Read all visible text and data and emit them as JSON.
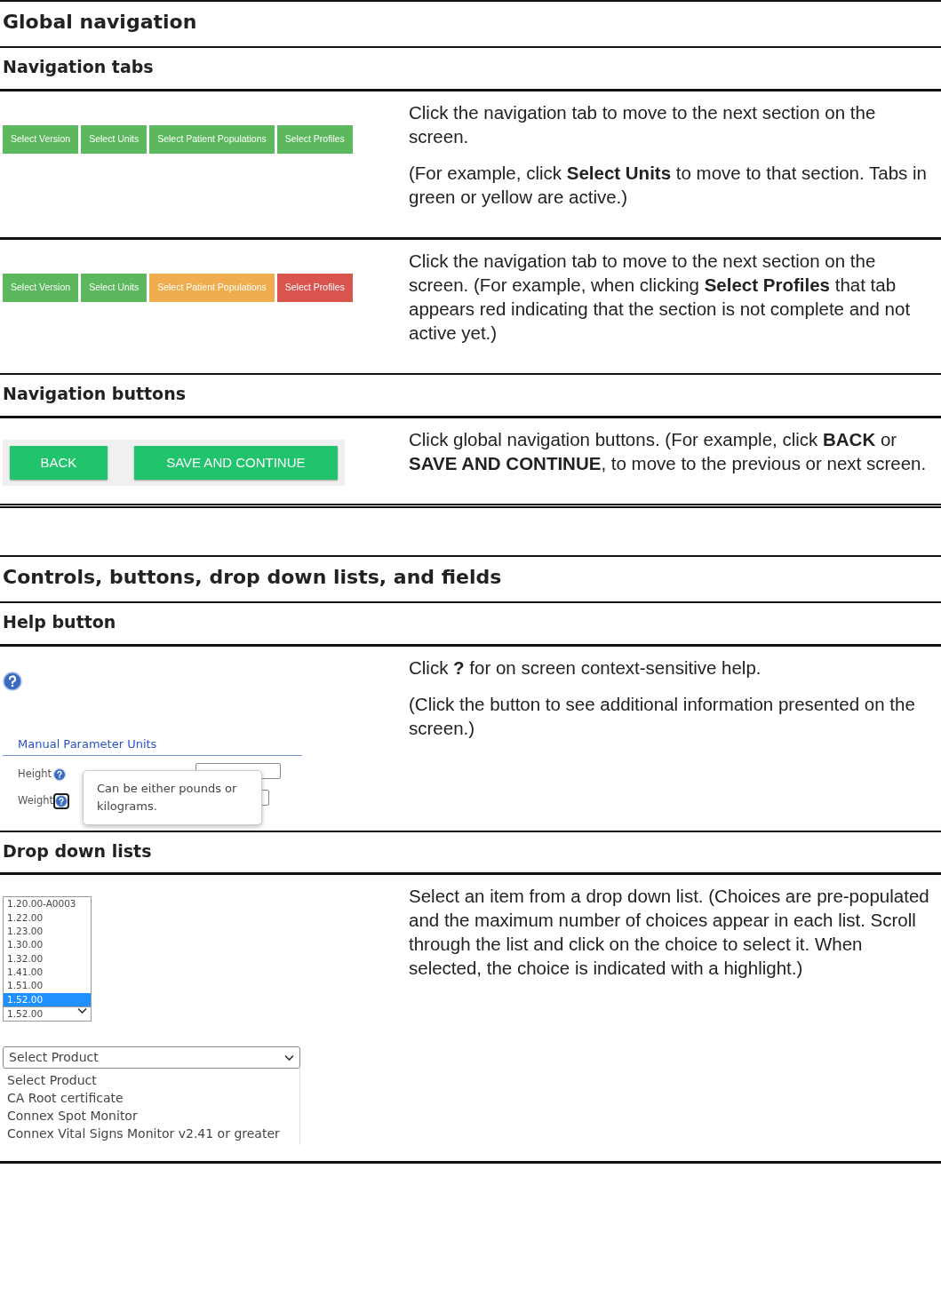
{
  "sections": [
    {
      "title": "Global navigation",
      "subsections": [
        {
          "title": "Navigation tabs",
          "rows": [
            {
              "demo": {
                "kind": "tabs",
                "tabs": [
                  {
                    "label": "Select Version",
                    "color": "#5cb85c"
                  },
                  {
                    "label": "Select Units",
                    "color": "#5cb85c"
                  },
                  {
                    "label": "Select Patient Populations",
                    "color": "#5cb85c"
                  },
                  {
                    "label": "Select Profiles",
                    "color": "#5cb85c"
                  }
                ]
              },
              "paragraphs": [
                "Click the navigation tab to move to the next section on the screen.",
                "(For example, click **Select Units** to move to that section. Tabs in green or yellow are active.)"
              ]
            },
            {
              "demo": {
                "kind": "tabs",
                "tabs": [
                  {
                    "label": "Select Version",
                    "color": "#5cb85c"
                  },
                  {
                    "label": "Select Units",
                    "color": "#5cb85c"
                  },
                  {
                    "label": "Select Patient Populations",
                    "color": "#f0ad4e"
                  },
                  {
                    "label": "Select Profiles",
                    "color": "#d9534f"
                  }
                ]
              },
              "paragraphs": [
                "Click the navigation tab to move to the next section on the screen. (For example, when clicking **Select Profiles** that tab appears red indicating that the section is not complete and not active yet.)"
              ]
            }
          ]
        },
        {
          "title": "Navigation buttons",
          "rows": [
            {
              "demo": {
                "kind": "buttons",
                "buttons": [
                  "BACK",
                  "SAVE AND CONTINUE"
                ]
              },
              "paragraphs": [
                "Click global navigation buttons. (For example, click **BACK** or **SAVE AND CONTINUE**, to move to the previous or next screen."
              ]
            }
          ]
        }
      ]
    },
    {
      "title": "Controls, buttons, drop down lists, and fields",
      "subsections": [
        {
          "title": "Help button",
          "rows": [
            {
              "demo": {
                "kind": "help",
                "panel_title": "Manual Parameter Units",
                "fields": [
                  {
                    "label": "Height",
                    "focused": false
                  },
                  {
                    "label": "Weight",
                    "focused": true
                  }
                ],
                "tooltip": "Can be either pounds or kilograms."
              },
              "paragraphs": [
                "Click **?** for on screen context-sensitive help.",
                "(Click the button to see additional information presented on the screen.)"
              ]
            }
          ]
        },
        {
          "title": "Drop down lists",
          "rows": [
            {
              "demo": {
                "kind": "lists",
                "listbox": {
                  "options": [
                    {
                      "label": "1.20.00-A0003",
                      "selected": false
                    },
                    {
                      "label": "1.22.00",
                      "selected": false
                    },
                    {
                      "label": "1.23.00",
                      "selected": false
                    },
                    {
                      "label": "1.30.00",
                      "selected": false
                    },
                    {
                      "label": "1.32.00",
                      "selected": false
                    },
                    {
                      "label": "1.41.00",
                      "selected": false
                    },
                    {
                      "label": "1.51.00",
                      "selected": false
                    },
                    {
                      "label": "1.52.00",
                      "selected": true
                    }
                  ],
                  "value": "1.52.00"
                },
                "dropdown": {
                  "value": "Select Product",
                  "options": [
                    "Select Product",
                    "CA Root certificate",
                    "Connex Spot Monitor",
                    "Connex Vital Signs Monitor v2.41 or greater"
                  ]
                }
              },
              "paragraphs": [
                "Select an item from a drop down list. (Choices are pre-populated and the maximum number of choices appear in each list. Scroll through the list and click on the choice to select it. When selected, the choice is indicated with a highlight.)"
              ]
            }
          ]
        }
      ]
    }
  ]
}
